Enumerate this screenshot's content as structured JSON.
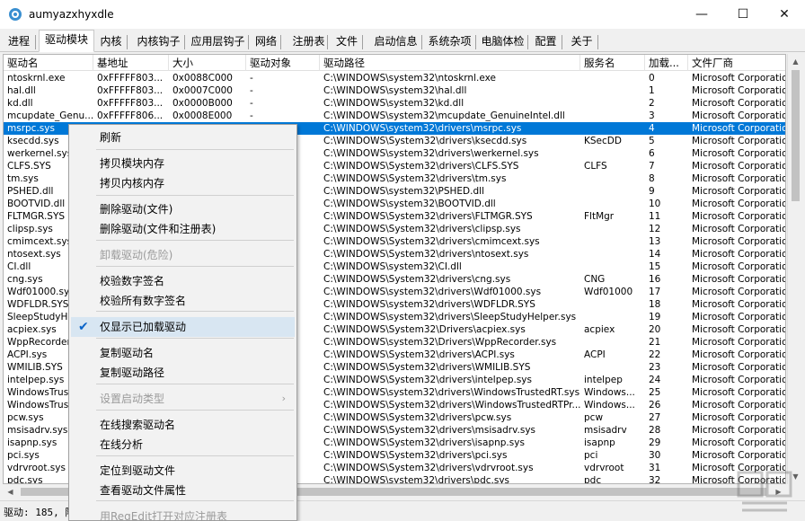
{
  "window": {
    "title": "aumyazxhyxdle",
    "min": "—",
    "max": "☐",
    "close": "✕"
  },
  "tabs": [
    {
      "label": "进程"
    },
    {
      "label": "驱动模块"
    },
    {
      "label": "内核"
    },
    {
      "label": "内核钩子"
    },
    {
      "label": "应用层钩子"
    },
    {
      "label": "网络"
    },
    {
      "label": "注册表"
    },
    {
      "label": "文件"
    },
    {
      "label": "启动信息"
    },
    {
      "label": "系统杂项"
    },
    {
      "label": "电脑体检"
    },
    {
      "label": "配置"
    },
    {
      "label": "关于"
    }
  ],
  "active_tab": "驱动模块",
  "columns": [
    "驱动名",
    "基地址",
    "大小",
    "驱动对象",
    "驱动路径",
    "服务名",
    "加载...",
    "文件厂商"
  ],
  "rows": [
    [
      "ntoskrnl.exe",
      "0xFFFFF803...",
      "0x0088C000",
      "-",
      "C:\\WINDOWS\\system32\\ntoskrnl.exe",
      "",
      "0",
      "Microsoft Corporation"
    ],
    [
      "hal.dll",
      "0xFFFFF803...",
      "0x0007C000",
      "-",
      "C:\\WINDOWS\\system32\\hal.dll",
      "",
      "1",
      "Microsoft Corporation"
    ],
    [
      "kd.dll",
      "0xFFFFF803...",
      "0x0000B000",
      "-",
      "C:\\WINDOWS\\system32\\kd.dll",
      "",
      "2",
      "Microsoft Corporation"
    ],
    [
      "mcupdate_Genu...",
      "0xFFFFF806...",
      "0x0008E000",
      "-",
      "C:\\WINDOWS\\system32\\mcupdate_GenuineIntel.dll",
      "",
      "3",
      "Microsoft Corporation"
    ],
    [
      "msrpc.sys",
      "",
      "",
      "",
      "C:\\WINDOWS\\system32\\drivers\\msrpc.sys",
      "",
      "4",
      "Microsoft Corporation"
    ],
    [
      "ksecdd.sys",
      "",
      "",
      "",
      "C:\\WINDOWS\\System32\\drivers\\ksecdd.sys",
      "KSecDD",
      "5",
      "Microsoft Corporation"
    ],
    [
      "werkernel.sys",
      "",
      "",
      "",
      "C:\\WINDOWS\\system32\\drivers\\werkernel.sys",
      "",
      "6",
      "Microsoft Corporation"
    ],
    [
      "CLFS.SYS",
      "",
      "",
      "",
      "C:\\WINDOWS\\System32\\drivers\\CLFS.SYS",
      "CLFS",
      "7",
      "Microsoft Corporation"
    ],
    [
      "tm.sys",
      "",
      "",
      "",
      "C:\\WINDOWS\\System32\\drivers\\tm.sys",
      "",
      "8",
      "Microsoft Corporation"
    ],
    [
      "PSHED.dll",
      "",
      "",
      "",
      "C:\\WINDOWS\\system32\\PSHED.dll",
      "",
      "9",
      "Microsoft Corporation"
    ],
    [
      "BOOTVID.dll",
      "",
      "",
      "",
      "C:\\WINDOWS\\system32\\BOOTVID.dll",
      "",
      "10",
      "Microsoft Corporation"
    ],
    [
      "FLTMGR.SYS",
      "",
      "",
      "",
      "C:\\WINDOWS\\System32\\drivers\\FLTMGR.SYS",
      "FltMgr",
      "11",
      "Microsoft Corporation"
    ],
    [
      "clipsp.sys",
      "",
      "",
      "",
      "C:\\WINDOWS\\System32\\drivers\\clipsp.sys",
      "",
      "12",
      "Microsoft Corporation"
    ],
    [
      "cmimcext.sys",
      "",
      "",
      "",
      "C:\\WINDOWS\\System32\\drivers\\cmimcext.sys",
      "",
      "13",
      "Microsoft Corporation"
    ],
    [
      "ntosext.sys",
      "",
      "",
      "",
      "C:\\WINDOWS\\System32\\drivers\\ntosext.sys",
      "",
      "14",
      "Microsoft Corporation"
    ],
    [
      "CI.dll",
      "",
      "",
      "",
      "C:\\WINDOWS\\system32\\CI.dll",
      "",
      "15",
      "Microsoft Corporation"
    ],
    [
      "cng.sys",
      "",
      "",
      "",
      "C:\\WINDOWS\\System32\\drivers\\cng.sys",
      "CNG",
      "16",
      "Microsoft Corporation"
    ],
    [
      "Wdf01000.sys",
      "",
      "",
      "",
      "C:\\WINDOWS\\system32\\drivers\\Wdf01000.sys",
      "Wdf01000",
      "17",
      "Microsoft Corporation"
    ],
    [
      "WDFLDR.SYS",
      "",
      "",
      "",
      "C:\\WINDOWS\\system32\\drivers\\WDFLDR.SYS",
      "",
      "18",
      "Microsoft Corporation"
    ],
    [
      "SleepStudyHe...",
      "",
      "",
      "",
      "C:\\WINDOWS\\system32\\drivers\\SleepStudyHelper.sys",
      "",
      "19",
      "Microsoft Corporation"
    ],
    [
      "acpiex.sys",
      "",
      "",
      "",
      "C:\\WINDOWS\\System32\\Drivers\\acpiex.sys",
      "acpiex",
      "20",
      "Microsoft Corporation"
    ],
    [
      "WppRecorder...",
      "",
      "",
      "",
      "C:\\WINDOWS\\system32\\Drivers\\WppRecorder.sys",
      "",
      "21",
      "Microsoft Corporation"
    ],
    [
      "ACPI.sys",
      "",
      "",
      "",
      "C:\\WINDOWS\\System32\\drivers\\ACPI.sys",
      "ACPI",
      "22",
      "Microsoft Corporation"
    ],
    [
      "WMILIB.SYS",
      "",
      "",
      "",
      "C:\\WINDOWS\\System32\\drivers\\WMILIB.SYS",
      "",
      "23",
      "Microsoft Corporation"
    ],
    [
      "intelpep.sys",
      "",
      "",
      "",
      "C:\\WINDOWS\\System32\\drivers\\intelpep.sys",
      "intelpep",
      "24",
      "Microsoft Corporation"
    ],
    [
      "WindowsTrust...",
      "",
      "",
      "",
      "C:\\WINDOWS\\system32\\drivers\\WindowsTrustedRT.sys",
      "Windows...",
      "25",
      "Microsoft Corporation"
    ],
    [
      "WindowsTrust...",
      "",
      "",
      "",
      "C:\\WINDOWS\\System32\\drivers\\WindowsTrustedRTPr...",
      "Windows...",
      "26",
      "Microsoft Corporation"
    ],
    [
      "pcw.sys",
      "",
      "",
      "",
      "C:\\WINDOWS\\System32\\drivers\\pcw.sys",
      "pcw",
      "27",
      "Microsoft Corporation"
    ],
    [
      "msisadrv.sys",
      "",
      "",
      "",
      "C:\\WINDOWS\\System32\\drivers\\msisadrv.sys",
      "msisadrv",
      "28",
      "Microsoft Corporation"
    ],
    [
      "isapnp.sys",
      "",
      "",
      "",
      "C:\\WINDOWS\\System32\\drivers\\isapnp.sys",
      "isapnp",
      "29",
      "Microsoft Corporation"
    ],
    [
      "pci.sys",
      "",
      "",
      "",
      "C:\\WINDOWS\\System32\\drivers\\pci.sys",
      "pci",
      "30",
      "Microsoft Corporation"
    ],
    [
      "vdrvroot.sys",
      "",
      "",
      "",
      "C:\\WINDOWS\\System32\\drivers\\vdrvroot.sys",
      "vdrvroot",
      "31",
      "Microsoft Corporation"
    ],
    [
      "pdc.sys",
      "",
      "",
      "",
      "C:\\WINDOWS\\system32\\drivers\\pdc.sys",
      "pdc",
      "32",
      "Microsoft Corporation"
    ]
  ],
  "selected_row": 4,
  "context_menu": {
    "items": [
      {
        "label": "刷新",
        "disabled": false
      },
      {
        "label": "拷贝模块内存",
        "disabled": false
      },
      {
        "label": "拷贝内核内存",
        "disabled": false
      },
      {
        "label": "删除驱动(文件)",
        "disabled": false
      },
      {
        "label": "删除驱动(文件和注册表)",
        "disabled": false
      },
      {
        "label": "卸载驱动(危险)",
        "disabled": true
      },
      {
        "label": "校验数字签名",
        "disabled": false
      },
      {
        "label": "校验所有数字签名",
        "disabled": false
      },
      {
        "label": "仅显示已加载驱动",
        "disabled": false,
        "checked": true
      },
      {
        "label": "复制驱动名",
        "disabled": false
      },
      {
        "label": "复制驱动路径",
        "disabled": false
      },
      {
        "label": "设置启动类型",
        "disabled": true,
        "submenu": true
      },
      {
        "label": "在线搜索驱动名",
        "disabled": false
      },
      {
        "label": "在线分析",
        "disabled": false
      },
      {
        "label": "定位到驱动文件",
        "disabled": false
      },
      {
        "label": "查看驱动文件属性",
        "disabled": false
      },
      {
        "label": "用RegEdit打开对应注册表",
        "disabled": true
      }
    ],
    "submenu_arrow": "›",
    "check_glyph": "✔"
  },
  "status": {
    "text": "驱动: 185, 隐"
  },
  "colors": {
    "selection": "#0078d7",
    "accent": "#3a8fd0"
  }
}
